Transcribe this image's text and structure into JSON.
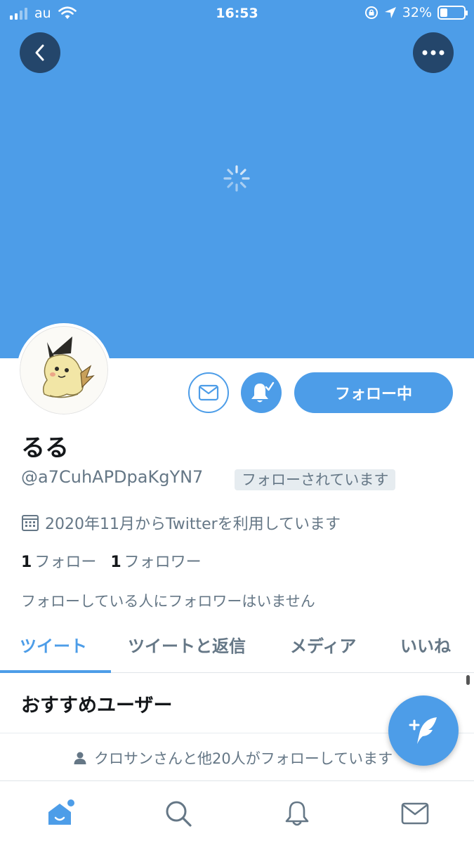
{
  "status_bar": {
    "carrier": "au",
    "time": "16:53",
    "battery": "32%",
    "battery_level": 0.32
  },
  "header": {
    "back_icon": "chevron-left-icon",
    "more_icon": "more-horizontal-icon",
    "loading_icon": "spinner-icon"
  },
  "actions": {
    "message_icon": "envelope-icon",
    "notification_icon": "bell-check-icon",
    "follow_label": "フォロー中"
  },
  "profile": {
    "name": "るる",
    "handle": "@a7CuhAPDpaKgYN7",
    "follows_you": "フォローされています",
    "joined": "2020年11月からTwitterを利用しています",
    "following_count": "1",
    "following_label": "フォロー",
    "followers_count": "1",
    "followers_label": "フォロワー",
    "mutual_note": "フォローしている人にフォロワーはいません"
  },
  "tabs": [
    {
      "label": "ツイート",
      "active": true
    },
    {
      "label": "ツイートと返信",
      "active": false
    },
    {
      "label": "メディア",
      "active": false
    },
    {
      "label": "いいね",
      "active": false
    }
  ],
  "recommendations": {
    "title": "おすすめユーザー",
    "followed_by": "クロサンさんと他20人がフォローしています"
  },
  "compose_icon": "compose-feather-icon",
  "bottom_nav": [
    {
      "icon": "home-icon",
      "active": true
    },
    {
      "icon": "search-icon",
      "active": false
    },
    {
      "icon": "bell-icon",
      "active": false
    },
    {
      "icon": "envelope-icon",
      "active": false
    }
  ],
  "colors": {
    "accent": "#4d9de8",
    "banner": "#4d9de8",
    "round_button": "#24466b",
    "secondary_text": "#657786"
  }
}
